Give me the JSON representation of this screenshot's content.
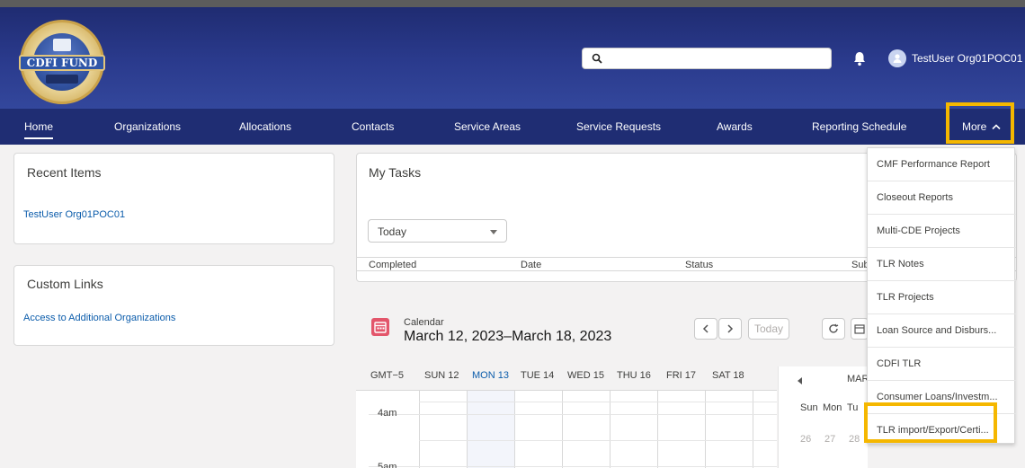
{
  "header": {
    "logo_text": "CDFI FUND",
    "search": {
      "value": "",
      "placeholder": ""
    },
    "user_name": "TestUser Org01POC01",
    "notification_icon": "bell-icon",
    "accent_color": "#f5b700"
  },
  "nav": {
    "items": [
      {
        "label": "Home",
        "active": true
      },
      {
        "label": "Organizations"
      },
      {
        "label": "Allocations"
      },
      {
        "label": "Contacts"
      },
      {
        "label": "Service Areas"
      },
      {
        "label": "Service Requests"
      },
      {
        "label": "Awards"
      },
      {
        "label": "Reporting Schedule"
      }
    ],
    "more_label": "More"
  },
  "more_menu": {
    "items": [
      "CMF Performance Report",
      "Closeout Reports",
      "Multi-CDE Projects",
      "TLR Notes",
      "TLR Projects",
      "Loan Source and Disburs...",
      "CDFI TLR",
      "Consumer Loans/Investm...",
      "TLR import/Export/Certi..."
    ]
  },
  "recent_items": {
    "title": "Recent Items",
    "items": [
      "TestUser Org01POC01"
    ]
  },
  "custom_links": {
    "title": "Custom Links",
    "items": [
      "Access to Additional Organizations"
    ]
  },
  "tasks": {
    "title": "My Tasks",
    "filter_value": "Today",
    "columns": [
      "Completed",
      "Date",
      "Status",
      "Sub"
    ]
  },
  "calendar": {
    "label": "Calendar",
    "range": "March 12, 2023–March 18, 2023",
    "today_button": "Today",
    "timezone": "GMT−5",
    "days": [
      "SUN 12",
      "MON 13",
      "TUE 14",
      "WED 15",
      "THU 16",
      "FRI 17",
      "SAT 18"
    ],
    "times": [
      "4am",
      "5am"
    ],
    "mini": {
      "month": "MAR",
      "weekdays": [
        "Sun",
        "Mon",
        "Tu"
      ],
      "dates": [
        "26",
        "27",
        "28"
      ]
    }
  }
}
